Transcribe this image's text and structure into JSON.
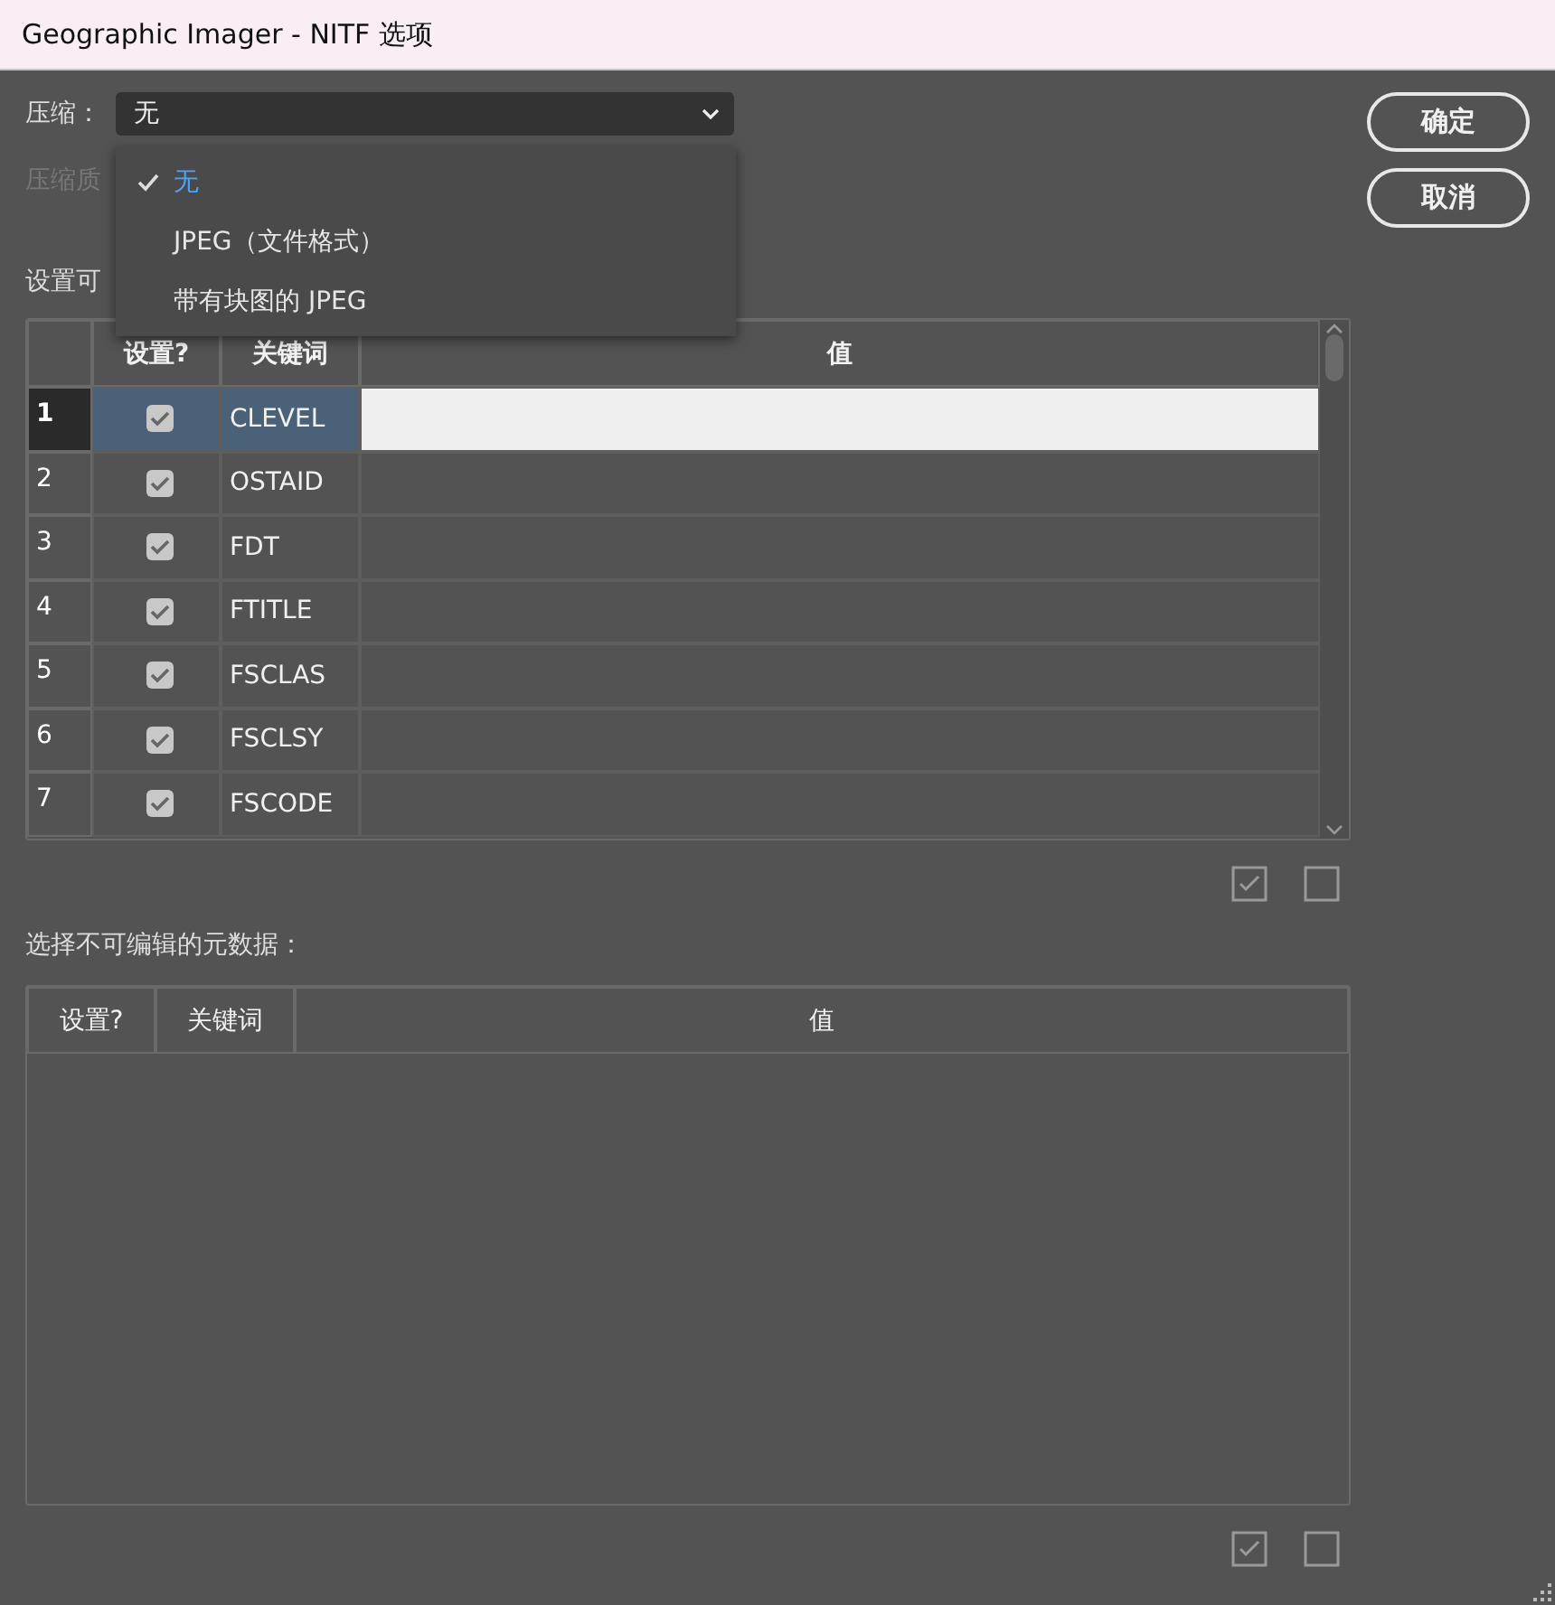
{
  "window": {
    "title": "Geographic Imager - NITF 选项"
  },
  "compression": {
    "label": "压缩：",
    "value": "无",
    "options": [
      {
        "label": "无",
        "selected": true
      },
      {
        "label": "JPEG（文件格式）",
        "selected": false
      },
      {
        "label": "带有块图的 JPEG",
        "selected": false
      }
    ]
  },
  "quality_label": "压缩质",
  "editable_label": "设置可",
  "editable_table": {
    "columns": [
      "设置?",
      "关键词",
      "值"
    ],
    "rows": [
      {
        "number": "1",
        "checked": true,
        "keyword": "CLEVEL",
        "selected": true
      },
      {
        "number": "2",
        "checked": true,
        "keyword": "OSTAID",
        "selected": false
      },
      {
        "number": "3",
        "checked": true,
        "keyword": "FDT",
        "selected": false
      },
      {
        "number": "4",
        "checked": true,
        "keyword": "FTITLE",
        "selected": false
      },
      {
        "number": "5",
        "checked": true,
        "keyword": "FSCLAS",
        "selected": false
      },
      {
        "number": "6",
        "checked": true,
        "keyword": "FSCLSY",
        "selected": false
      },
      {
        "number": "7",
        "checked": true,
        "keyword": "FSCODE",
        "selected": false
      }
    ]
  },
  "readonly_label": "选择不可编辑的元数据：",
  "readonly_table": {
    "columns": [
      "设置?",
      "关键词",
      "值"
    ]
  },
  "buttons": [
    "确定",
    "取消"
  ]
}
